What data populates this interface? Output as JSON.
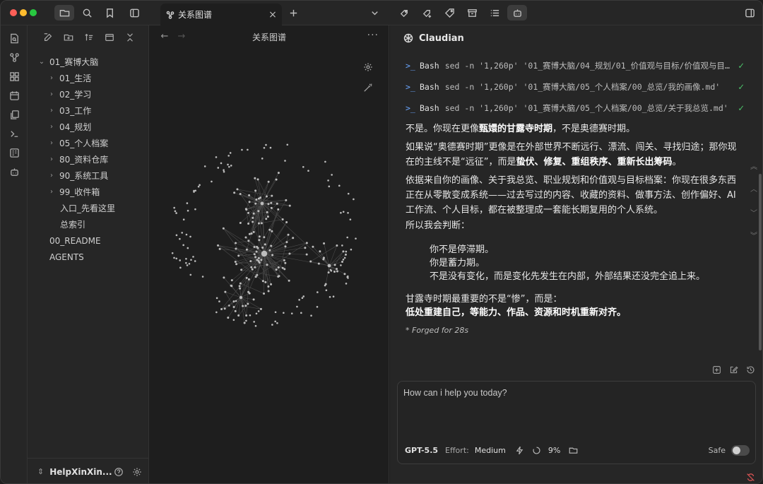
{
  "tab": {
    "title": "关系图谱",
    "close": "×"
  },
  "explorer": {
    "tree": [
      {
        "label": "01_赛博大脑",
        "chevron": "⌄",
        "indent": 0
      },
      {
        "label": "01_生活",
        "chevron": "›",
        "indent": 1
      },
      {
        "label": "02_学习",
        "chevron": "›",
        "indent": 1
      },
      {
        "label": "03_工作",
        "chevron": "›",
        "indent": 1
      },
      {
        "label": "04_规划",
        "chevron": "›",
        "indent": 1
      },
      {
        "label": "05_个人档案",
        "chevron": "›",
        "indent": 1
      },
      {
        "label": "80_资料仓库",
        "chevron": "›",
        "indent": 1
      },
      {
        "label": "90_系统工具",
        "chevron": "›",
        "indent": 1
      },
      {
        "label": "99_收件箱",
        "chevron": "›",
        "indent": 1
      },
      {
        "label": "入口_先看这里",
        "chevron": "",
        "indent": 2
      },
      {
        "label": "总索引",
        "chevron": "",
        "indent": 2
      },
      {
        "label": "00_README",
        "chevron": "",
        "indent": 0
      },
      {
        "label": "AGENTS",
        "chevron": "",
        "indent": 0
      }
    ],
    "vault_name": "HelpXinXin..."
  },
  "graph": {
    "title": "关系图谱",
    "back": "←",
    "forward": "→",
    "more": "···"
  },
  "chat": {
    "name": "Claudian",
    "tools": [
      {
        "prompt": ">_",
        "name": "Bash",
        "cmd": "sed -n '1,260p' '01_赛博大脑/04_规划/01_价值观与目标/价值观与目标...",
        "status": "✓"
      },
      {
        "prompt": ">_",
        "name": "Bash",
        "cmd": "sed -n '1,260p' '01_赛博大脑/05_个人档案/00_总览/我的画像.md'",
        "status": "✓"
      },
      {
        "prompt": ">_",
        "name": "Bash",
        "cmd": "sed -n '1,260p' '01_赛博大脑/05_个人档案/00_总览/关于我总览.md'",
        "status": "✓"
      }
    ],
    "p1": {
      "a": "不是。你现在更像",
      "b": "甄嬛的甘露寺时期",
      "c": "，不是奥德赛时期。"
    },
    "p2": {
      "a": "如果说“奥德赛时期”更像是在外部世界不断远行、漂流、闯关、寻找归途；那你现在的主线不是“远征”，而是",
      "b": "蛰伏、修复、重组秩序、重新长出筹码",
      "c": "。"
    },
    "p3": "依据来自你的画像、关于我总览、职业规划和价值观与目标档案：你现在很多东西正在从零散变成系统——过去写过的内容、收藏的资料、做事方法、创作偏好、AI 工作流、个人目标，都在被整理成一套能长期复用的个人系统。",
    "p4": "所以我会判断：",
    "quote": [
      "你不是停滞期。",
      "你是蓄力期。",
      "不是没有变化，而是变化先发生在内部，外部结果还没完全追上来。"
    ],
    "p5": "甘露寺时期最重要的不是“惨”，而是：",
    "p6": "低处重建自己，等能力、作品、资源和时机重新对齐。",
    "forged": "* Forged for 28s",
    "input": {
      "placeholder": "How can i help you today?",
      "model": "GPT-5.5",
      "effort_label": "Effort:",
      "effort_value": "Medium",
      "context_pct": "9%",
      "safe_label": "Safe"
    }
  },
  "colors": {
    "accent_blue": "#6aa6ff",
    "check_green": "#4cc36a",
    "alert_red": "#e05555"
  }
}
